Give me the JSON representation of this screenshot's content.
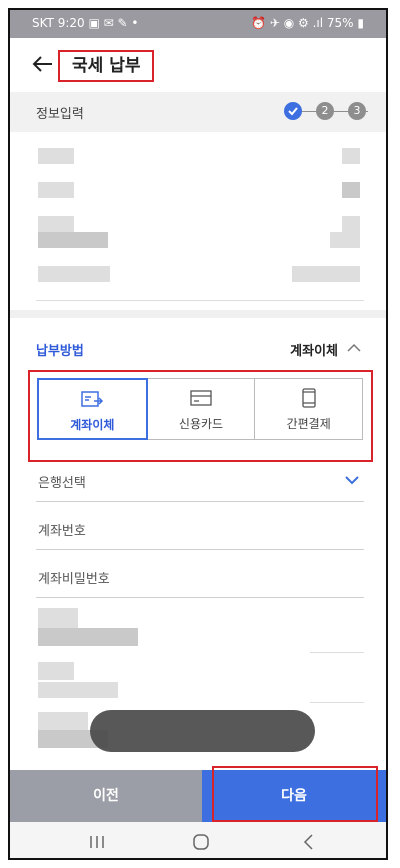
{
  "status_bar": {
    "left": "SKT 9:20 ▣ ✉ ✎ •",
    "right": "⏰ ✈ ◉ ⚙ .ıl 75% ▮"
  },
  "header": {
    "title": "국세 납부"
  },
  "steps": {
    "label": "정보입력",
    "step2": "2",
    "step3": "3"
  },
  "payment": {
    "label": "납부방법",
    "selected": "계좌이체",
    "methods": [
      {
        "label": "계좌이체",
        "icon": "bank-transfer-icon",
        "active": true
      },
      {
        "label": "신용카드",
        "icon": "credit-card-icon",
        "active": false
      },
      {
        "label": "간편결제",
        "icon": "mobile-pay-icon",
        "active": false
      }
    ]
  },
  "form": {
    "bank_select": "은행선택",
    "account_number": "계좌번호",
    "account_password": "계좌비밀번호"
  },
  "buttons": {
    "prev": "이전",
    "next": "다음"
  },
  "colors": {
    "accent": "#3d6fe0",
    "highlight": "#d8232a",
    "prev_bg": "#9b9ea6"
  }
}
